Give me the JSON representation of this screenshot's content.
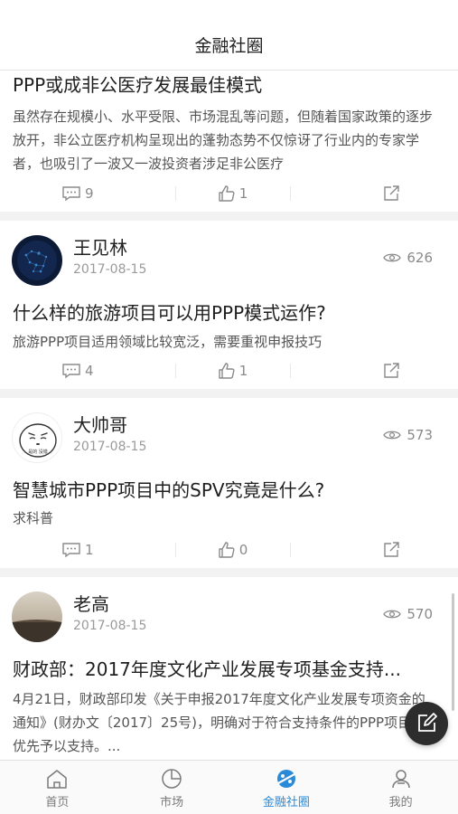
{
  "header": {
    "title": "金融社圈"
  },
  "posts": [
    {
      "title": "PPP或成非公医疗发展最佳模式",
      "summary": "虽然存在规模小、水平受限、市场混乱等问题，但随着国家政策的逐步放开，非公立医疗机构呈现出的蓬勃态势不仅惊讶了行业内的专家学者，也吸引了一波又一波投资者涉足非公医疗",
      "comments": "9",
      "likes": "1"
    },
    {
      "author": "王见林",
      "date": "2017-08-15",
      "views": "626",
      "title": "什么样的旅游项目可以用PPP模式运作?",
      "summary": "旅游PPP项目适用领域比较宽泛，需要重视申报技巧",
      "comments": "4",
      "likes": "1"
    },
    {
      "author": "大帅哥",
      "date": "2017-08-15",
      "views": "573",
      "title": "智慧城市PPP项目中的SPV究竟是什么?",
      "summary": "求科普",
      "comments": "1",
      "likes": "0",
      "avatar_text": "是的 没错"
    },
    {
      "author": "老高",
      "date": "2017-08-15",
      "views": "570",
      "title": "财政部：2017年度文化产业发展专项基金支持...",
      "summary": "4月21日，财政部印发《关于申报2017年度文化产业发展专项资金的通知》(财办文〔2017〕25号)，明确对于符合支持条件的PPP项目等优先予以支持。..."
    }
  ],
  "tabs": [
    {
      "label": "首页",
      "icon": "home-icon"
    },
    {
      "label": "市场",
      "icon": "pie-chart-icon"
    },
    {
      "label": "金融社圈",
      "icon": "finance-circle-icon",
      "active": true
    },
    {
      "label": "我的",
      "icon": "user-icon"
    }
  ],
  "colors": {
    "accent": "#2a8ad8",
    "text": "#1f1f1f",
    "muted": "#8a8a8a",
    "separator": "#f2f2f2",
    "fab": "#2d2d2d"
  }
}
